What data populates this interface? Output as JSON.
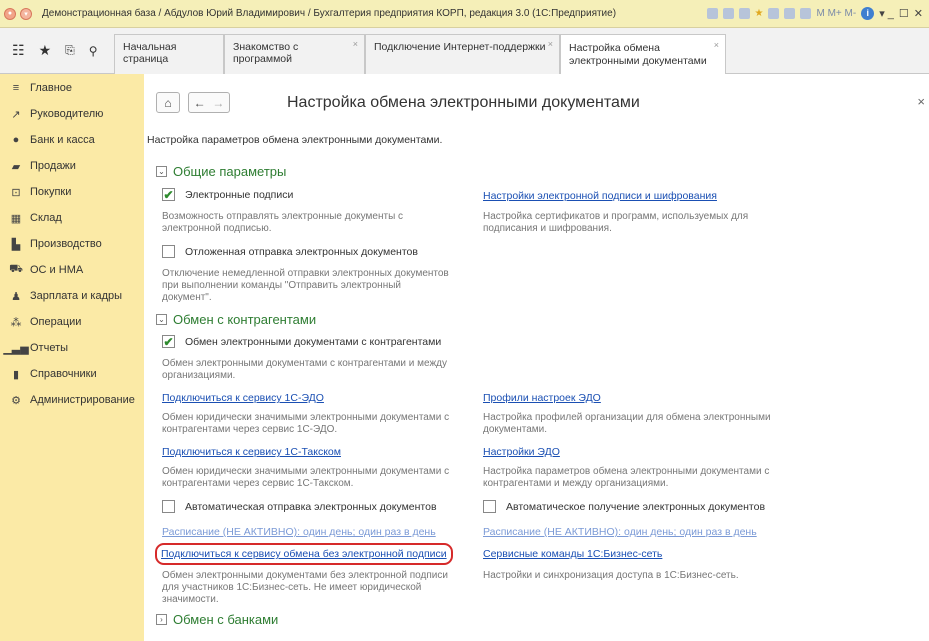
{
  "window": {
    "title": "Демонстрационная база / Абдулов Юрий Владимирович / Бухгалтерия предприятия КОРП, редакция 3.0 (1С:Предприятие)",
    "toolbar_text": "M  M+  M-"
  },
  "tabs": [
    {
      "label": "Начальная страница"
    },
    {
      "label": "Знакомство с программой"
    },
    {
      "label": "Подключение Интернет-поддержки"
    },
    {
      "label_line1": "Настройка обмена",
      "label_line2": "электронными документами"
    }
  ],
  "sidebar": {
    "items": [
      {
        "label": "Главное",
        "icon": "menu-icon"
      },
      {
        "label": "Руководителю",
        "icon": "chart-line-icon"
      },
      {
        "label": "Банк и касса",
        "icon": "coin-icon"
      },
      {
        "label": "Продажи",
        "icon": "bag-icon"
      },
      {
        "label": "Покупки",
        "icon": "cart-icon"
      },
      {
        "label": "Склад",
        "icon": "warehouse-icon"
      },
      {
        "label": "Производство",
        "icon": "factory-icon"
      },
      {
        "label": "ОС и НМА",
        "icon": "truck-icon"
      },
      {
        "label": "Зарплата и кадры",
        "icon": "person-icon"
      },
      {
        "label": "Операции",
        "icon": "operations-icon"
      },
      {
        "label": "Отчеты",
        "icon": "bar-chart-icon"
      },
      {
        "label": "Справочники",
        "icon": "book-icon"
      },
      {
        "label": "Администрирование",
        "icon": "gear-icon"
      }
    ]
  },
  "page": {
    "title": "Настройка обмена электронными документами",
    "description": "Настройка параметров обмена электронными документами."
  },
  "general": {
    "header": "Общие параметры",
    "esign_label": "Электронные подписи",
    "esign_note": "Возможность отправлять электронные документы с электронной подписью.",
    "esign_link": "Настройки электронной подписи и шифрования",
    "esign_link_note": "Настройка сертификатов и программ, используемых для подписания и шифрования.",
    "deferred_label": "Отложенная отправка электронных документов",
    "deferred_note": "Отключение немедленной отправки электронных документов при выполнении команды \"Отправить электронный документ\"."
  },
  "counterparties": {
    "header": "Обмен с контрагентами",
    "exchange_label": "Обмен электронными документами с контрагентами",
    "exchange_note": "Обмен электронными документами с контрагентами и между организациями.",
    "edo_link": "Подключиться к сервису 1С-ЭДО",
    "edo_note": "Обмен юридически значимыми электронными документами с контрагентами через сервис 1С-ЭДО.",
    "profiles_link": "Профили настроек ЭДО",
    "profiles_note": "Настройка профилей организации для обмена электронными документами.",
    "taxcom_link": "Подключиться к сервису 1С-Такском",
    "taxcom_note": "Обмен юридически значимыми электронными документами с контрагентами через сервис 1С-Такском.",
    "edo_settings_link": "Настройки ЭДО",
    "edo_settings_note": "Настройка параметров обмена электронными документами с контрагентами и между организациями.",
    "auto_send_label": "Автоматическая отправка электронных документов",
    "auto_send_schedule": "Расписание (НЕ АКТИВНО): один день; один раз в день",
    "auto_receive_label": "Автоматическое получение электронных документов",
    "auto_receive_schedule": "Расписание (НЕ АКТИВНО): один день; один раз в день",
    "nosign_link": "Подключиться к сервису обмена без электронной подписи",
    "nosign_note": "Обмен электронными документами без электронной подписи для участников 1С:Бизнес-сеть. Не имеет юридической значимости.",
    "service_link": "Сервисные команды 1С:Бизнес-сеть",
    "service_note": "Настройки и синхронизация доступа в 1С:Бизнес-сеть."
  },
  "banks": {
    "header": "Обмен с банками"
  },
  "colors": {
    "sidebar_bg": "#fbeaa6",
    "titlebar_bg": "#f5efb8",
    "section_green": "#2e7d32",
    "link_blue": "#1a4fb3",
    "highlight_red": "#d62a2a"
  }
}
